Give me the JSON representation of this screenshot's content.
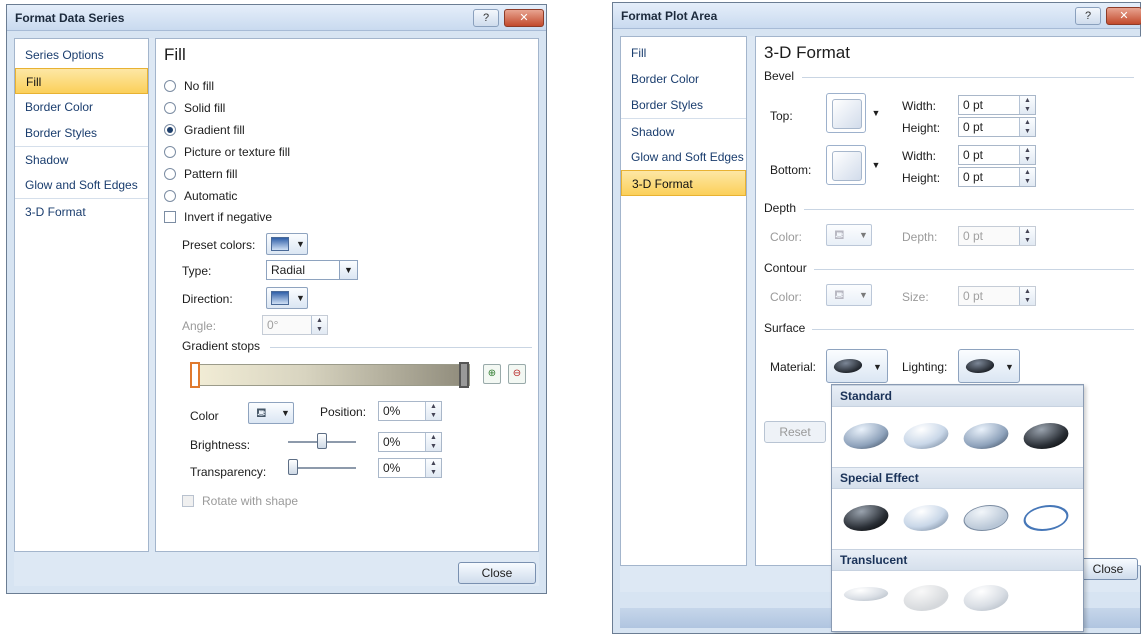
{
  "left_dialog": {
    "title": "Format Data Series",
    "help_label": "?",
    "close_x": "✕",
    "nav": [
      "Series Options",
      "Fill",
      "Border Color",
      "Border Styles",
      "Shadow",
      "Glow and Soft Edges",
      "3-D Format"
    ],
    "selected_nav": "Fill",
    "panel_title": "Fill",
    "fill_options": [
      "No fill",
      "Solid fill",
      "Gradient fill",
      "Picture or texture fill",
      "Pattern fill",
      "Automatic"
    ],
    "selected_fill": "Gradient fill",
    "invert_label": "Invert if negative",
    "preset_colors_label": "Preset colors:",
    "type_label": "Type:",
    "type_value": "Radial",
    "direction_label": "Direction:",
    "angle_label": "Angle:",
    "angle_value": "0°",
    "gradient_stops_label": "Gradient stops",
    "color_label": "Color",
    "position_label": "Position:",
    "position_value": "0%",
    "brightness_label": "Brightness:",
    "brightness_value": "0%",
    "transparency_label": "Transparency:",
    "transparency_value": "0%",
    "rotate_label": "Rotate with shape",
    "close_button": "Close"
  },
  "right_dialog": {
    "title": "Format Plot Area",
    "help_label": "?",
    "close_x": "✕",
    "nav": [
      "Fill",
      "Border Color",
      "Border Styles",
      "Shadow",
      "Glow and Soft Edges",
      "3-D Format"
    ],
    "selected_nav": "3-D Format",
    "panel_title": "3-D Format",
    "bevel_label": "Bevel",
    "top_label": "Top:",
    "bottom_label": "Bottom:",
    "width_label": "Width:",
    "height_label": "Height:",
    "top_width": "0 pt",
    "top_height": "0 pt",
    "bottom_width": "0 pt",
    "bottom_height": "0 pt",
    "depth_label": "Depth",
    "depth_color_label": "Color:",
    "depth_depth_label": "Depth:",
    "depth_value": "0 pt",
    "contour_label": "Contour",
    "contour_color_label": "Color:",
    "contour_size_label": "Size:",
    "contour_value": "0 pt",
    "surface_label": "Surface",
    "material_label": "Material:",
    "lighting_label": "Lighting:",
    "reset_button": "Reset",
    "close_button": "Close"
  },
  "material_popup": {
    "standard_label": "Standard",
    "special_label": "Special Effect",
    "translucent_label": "Translucent"
  }
}
